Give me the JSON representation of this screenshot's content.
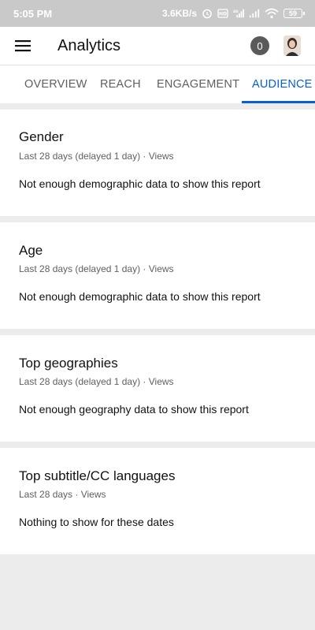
{
  "status_bar": {
    "time": "5:05 PM",
    "speed": "3.6KB/s",
    "battery": "59"
  },
  "app_bar": {
    "title": "Analytics",
    "notification_count": "0"
  },
  "tabs": [
    {
      "label": "OVERVIEW",
      "active": false
    },
    {
      "label": "REACH",
      "active": false
    },
    {
      "label": "ENGAGEMENT",
      "active": false
    },
    {
      "label": "AUDIENCE",
      "active": true
    }
  ],
  "cards": [
    {
      "title": "Gender",
      "subtitle": "Last 28 days (delayed 1 day) · Views",
      "message": "Not enough demographic data to show this report"
    },
    {
      "title": "Age",
      "subtitle": "Last 28 days (delayed 1 day) · Views",
      "message": "Not enough demographic data to show this report"
    },
    {
      "title": "Top geographies",
      "subtitle": "Last 28 days (delayed 1 day) · Views",
      "message": "Not enough geography data to show this report"
    },
    {
      "title": "Top subtitle/CC languages",
      "subtitle": "Last 28 days · Views",
      "message": "Nothing to show for these dates"
    }
  ],
  "colors": {
    "accent": "#065fd4",
    "background": "#ececec",
    "status_bar": "#c9c9c9"
  }
}
